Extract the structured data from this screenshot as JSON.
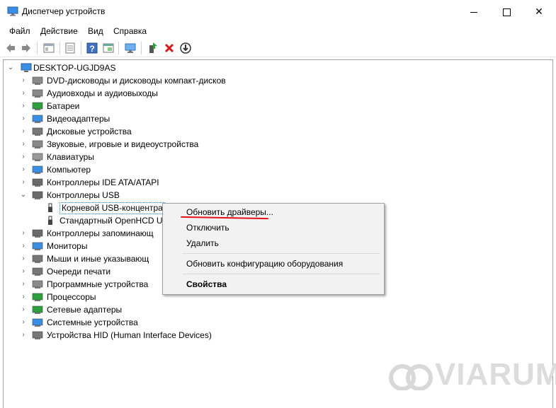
{
  "window": {
    "title": "Диспетчер устройств",
    "min": "—",
    "max": "☐",
    "close": "✕"
  },
  "menu": [
    "Файл",
    "Действие",
    "Вид",
    "Справка"
  ],
  "tree": {
    "root": "DESKTOP-UGJD9AS",
    "categories": [
      "DVD-дисководы и дисководы компакт-дисков",
      "Аудиовходы и аудиовыходы",
      "Батареи",
      "Видеоадаптеры",
      "Дисковые устройства",
      "Звуковые, игровые и видеоустройства",
      "Клавиатуры",
      "Компьютер",
      "Контроллеры IDE ATA/ATAPI",
      "Контроллеры USB",
      "Корневой USB-концентра",
      "Стандартный OpenHCD U",
      "Контроллеры запоминающ",
      "Мониторы",
      "Мыши и иные указывающ",
      "Очереди печати",
      "Программные устройства",
      "Процессоры",
      "Сетевые адаптеры",
      "Системные устройства",
      "Устройства HID (Human Interface Devices)"
    ]
  },
  "context_menu": {
    "update": "Обновить драйверы...",
    "disable": "Отключить",
    "remove": "Удалить",
    "scan": "Обновить конфигурацию оборудования",
    "properties": "Свойства"
  },
  "watermark": "VIARUM",
  "colors": {
    "accent_red": "#e8101a",
    "icon_blue": "#2f7fd8",
    "icon_green": "#2aa23b"
  }
}
